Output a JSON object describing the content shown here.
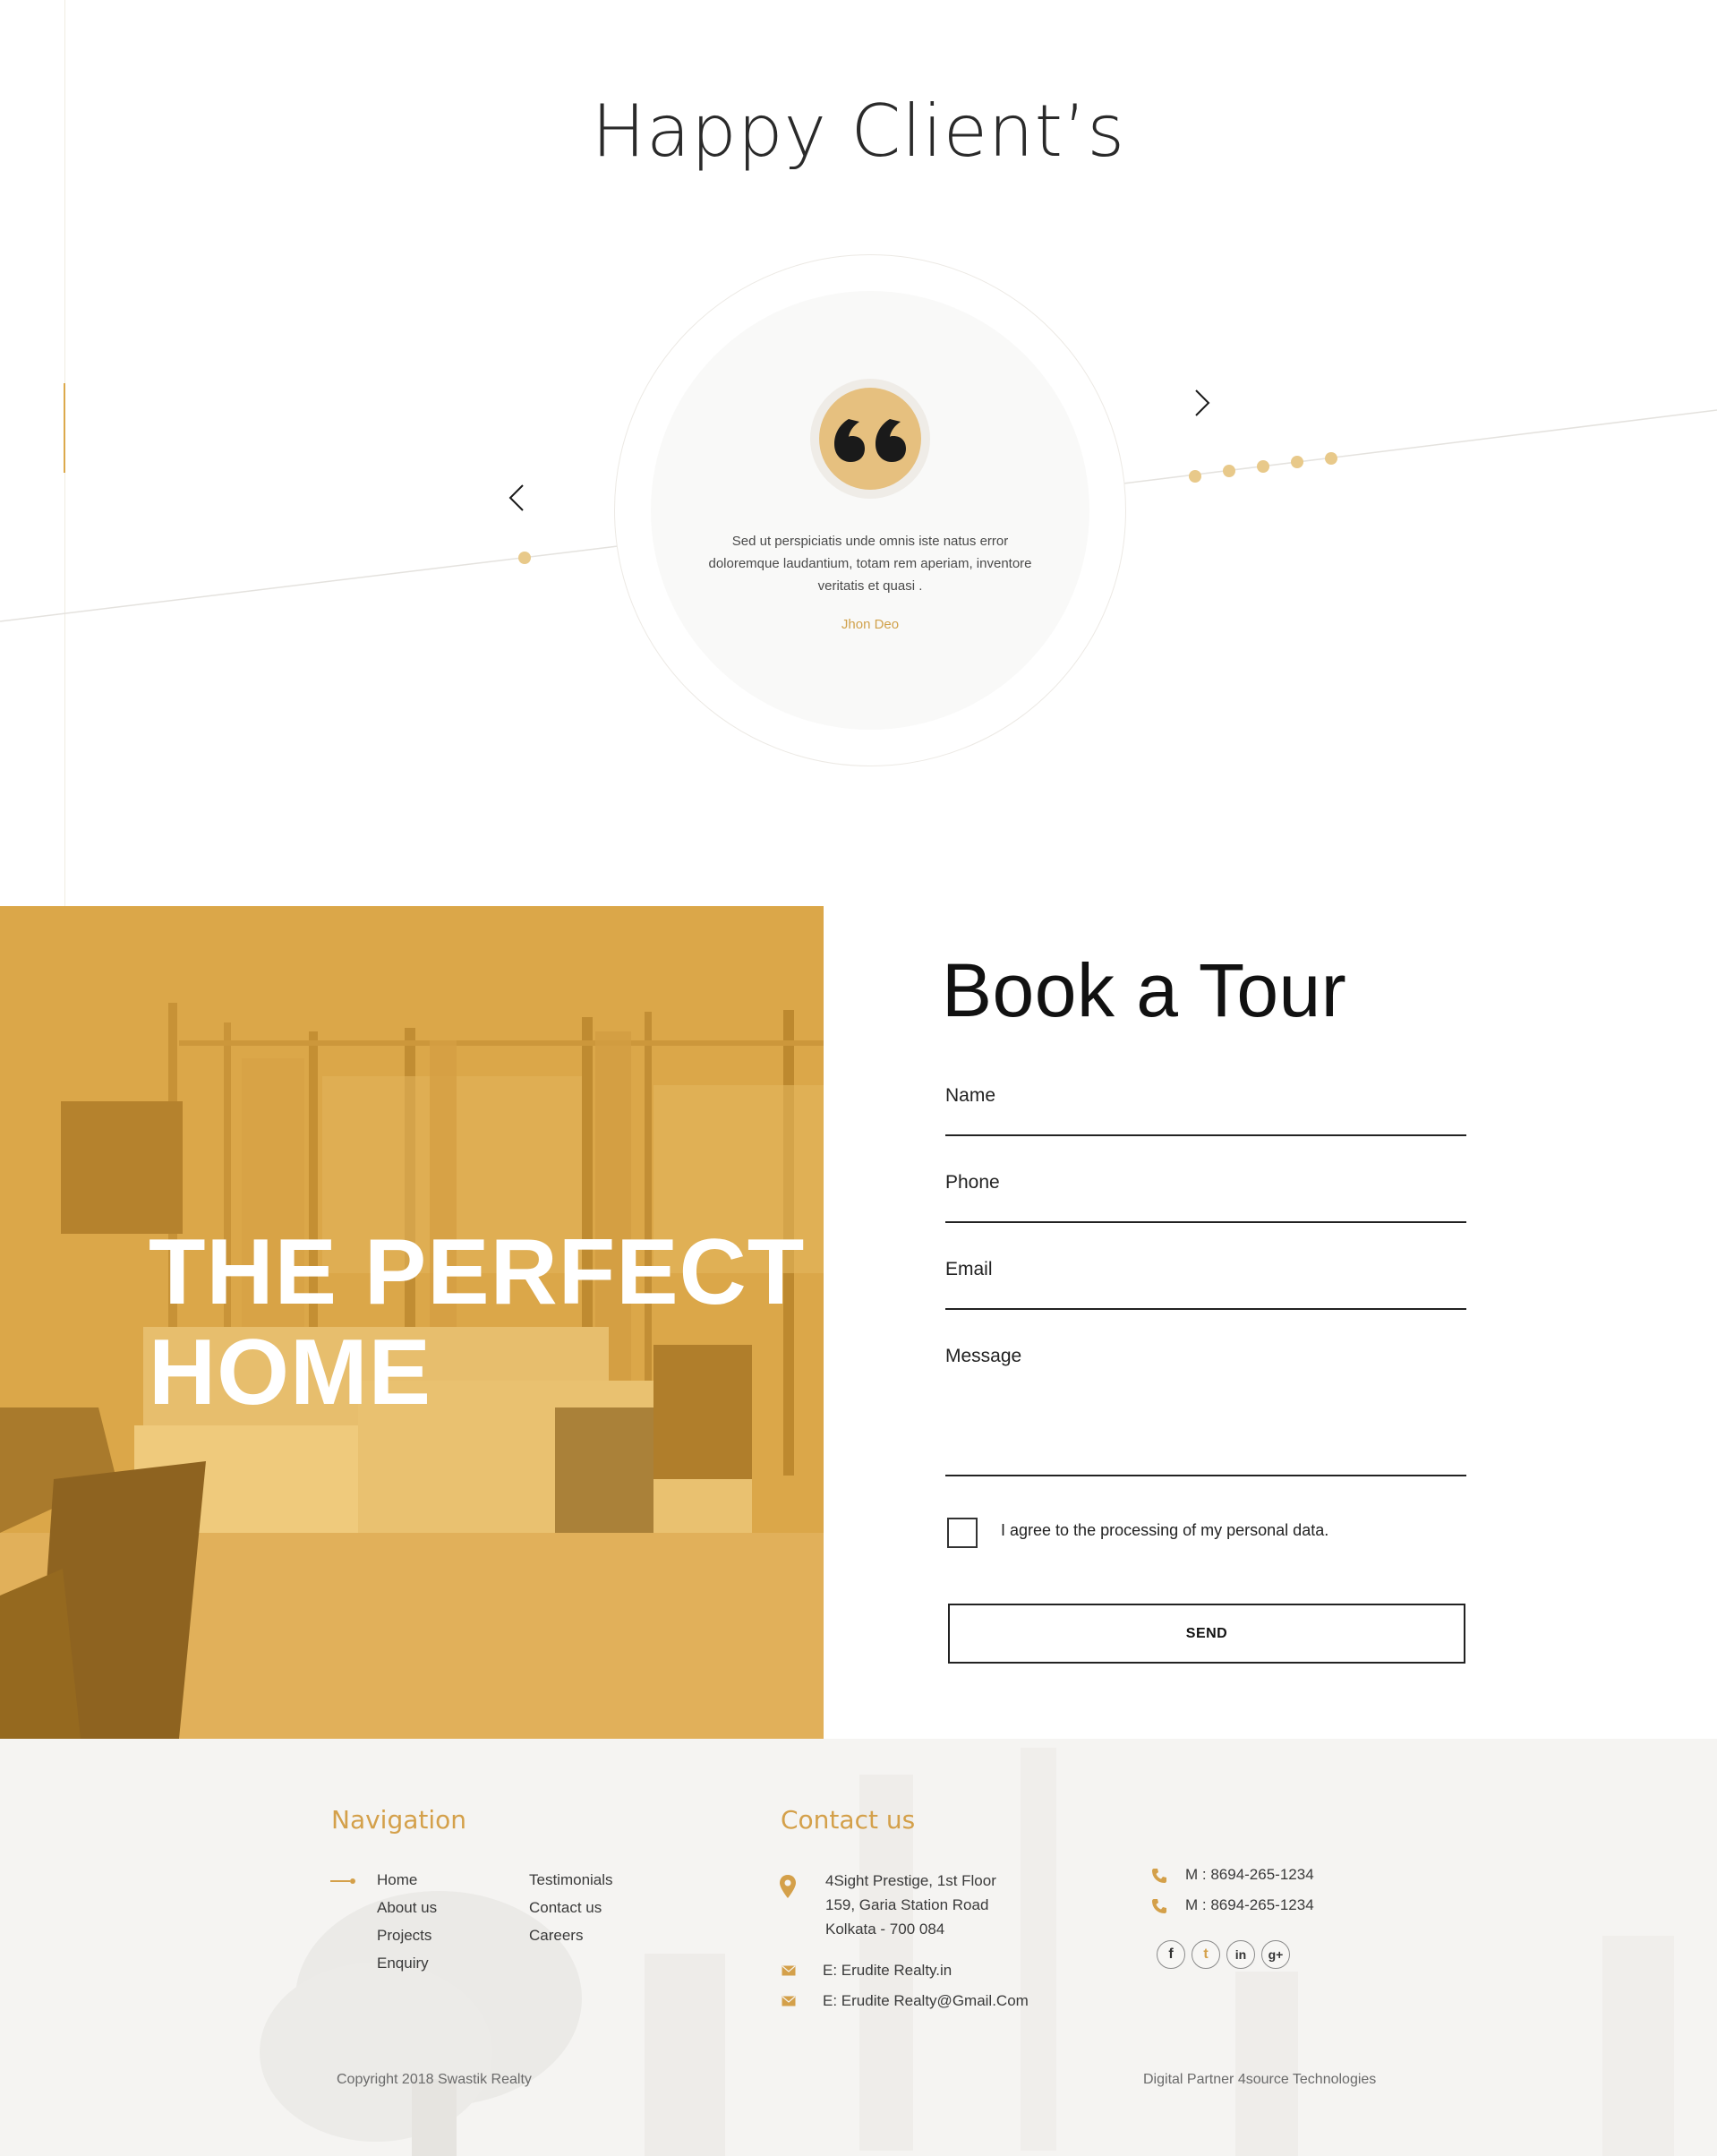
{
  "testimonials": {
    "title": "Happy Client’s",
    "quote": "Sed ut perspiciatis unde omnis iste natus error doloremque laudantium, totam rem aperiam, inventore veritatis et quasi .",
    "author": "Jhon Deo",
    "prev_icon": "chevron-left-icon",
    "next_icon": "chevron-right-icon",
    "quote_icon": "quote-icon",
    "dots_count_left": 1,
    "dots_count_right": 5
  },
  "hero": {
    "line1": "THE PERFECT",
    "line2": "HOME",
    "overlay_color": "#d9a546"
  },
  "booking": {
    "title": "Book a Tour",
    "fields": [
      {
        "label": "Name"
      },
      {
        "label": "Phone"
      },
      {
        "label": "Email"
      },
      {
        "label": "Message"
      }
    ],
    "consent": "I agree to the processing of my personal data.",
    "consent_checked": false,
    "send": "SEND"
  },
  "footer": {
    "nav_heading": "Navigation",
    "nav_col1": [
      "Home",
      "About us",
      "Projects",
      "Enquiry"
    ],
    "nav_col2": [
      "Testimonials",
      "Contact us",
      "Careers"
    ],
    "contact_heading": "Contact us",
    "address": [
      "4Sight Prestige, 1st Floor",
      "159, Garia Station Road",
      "Kolkata - 700 084"
    ],
    "emails": [
      "E: Erudite Realty.in",
      "E: Erudite Realty@Gmail.Com"
    ],
    "phones": [
      "M : 8694-265-1234",
      "M : 8694-265-1234"
    ],
    "social": [
      {
        "icon": "facebook-icon",
        "glyph": "f"
      },
      {
        "icon": "twitter-icon",
        "glyph": "t"
      },
      {
        "icon": "linkedin-icon",
        "glyph": "in"
      },
      {
        "icon": "google-plus-icon",
        "glyph": "g+"
      }
    ],
    "copyright": "Copyright 2018 Swastik Realty",
    "partner": "Digital Partner 4source Technologies",
    "accent_color": "#d4a04a"
  }
}
